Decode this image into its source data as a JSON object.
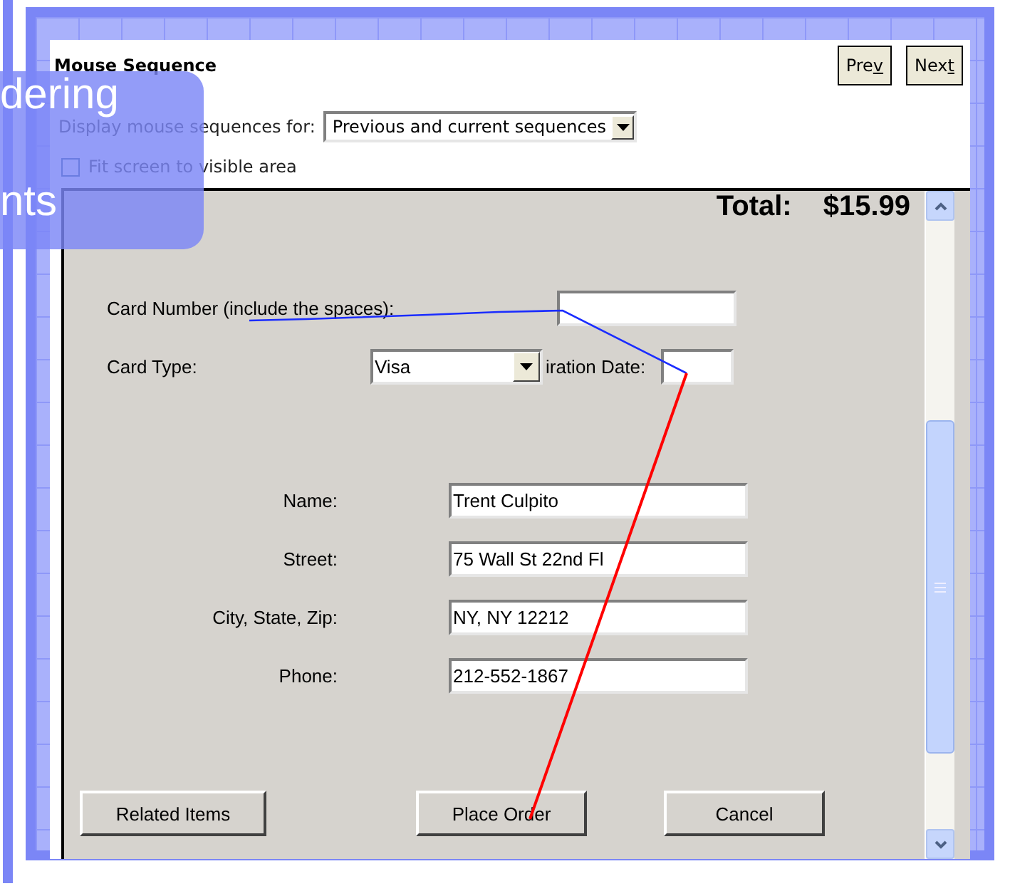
{
  "window": {
    "title": "Mouse Sequence",
    "nav_buttons": [
      {
        "before": "Pre",
        "access_key": "v"
      },
      {
        "before": "Nex",
        "access_key": "t"
      }
    ]
  },
  "display_filter": {
    "label": "Display mouse sequences for:",
    "value": "Previous and current sequences"
  },
  "fit_checkbox": {
    "label": "Fit screen to visible area",
    "checked": false
  },
  "form": {
    "total_label": "Total:",
    "total_value": "$15.99",
    "card_number": {
      "label": "Card Number (include the spaces):"
    },
    "card_type": {
      "label": "Card Type:",
      "value": "Visa"
    },
    "expiration": {
      "label": "iration Date:"
    },
    "address_fields": [
      {
        "label": "Name:",
        "value": "Trent Culpito"
      },
      {
        "label": "Street:",
        "value": "75 Wall St 22nd Fl"
      },
      {
        "label": "City, State, Zip:",
        "value": "NY, NY 12212"
      },
      {
        "label": "Phone:",
        "value": "212-552-1867"
      }
    ],
    "buttons": [
      "Related Items",
      "Place Order",
      "Cancel"
    ]
  },
  "overlay": {
    "lines": [
      "dering",
      "nts"
    ]
  }
}
